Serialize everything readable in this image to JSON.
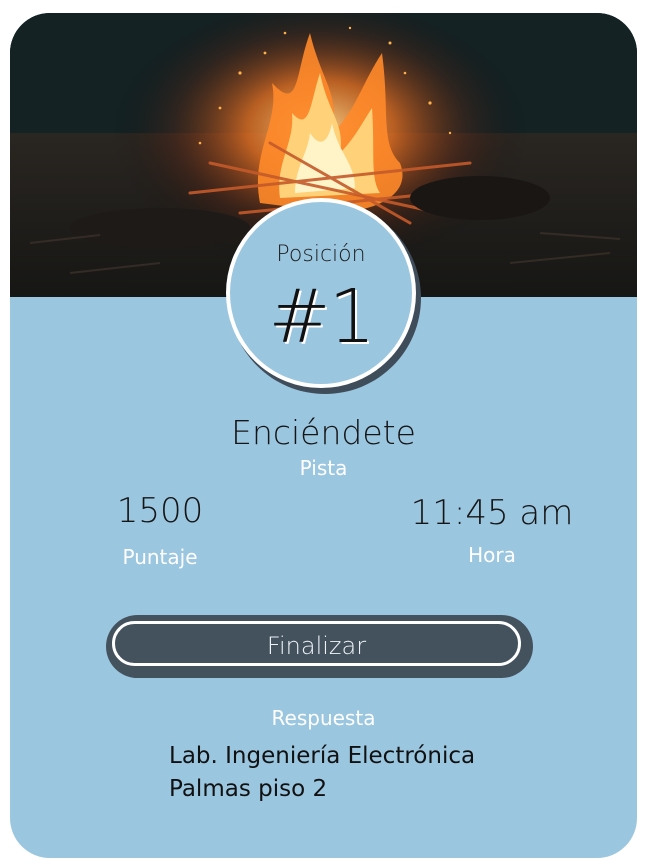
{
  "position": {
    "label": "Posición",
    "value": "#1"
  },
  "track": {
    "title": "Enciéndete",
    "subtitle": "Pista"
  },
  "stats": {
    "score_value": "1500",
    "score_label": "Puntaje",
    "time_value": "11:45 am",
    "time_label": "Hora"
  },
  "actions": {
    "finish_label": "Finalizar"
  },
  "answer": {
    "label": "Respuesta",
    "line1": "Lab. Ingeniería Electrónica",
    "line2": "Palmas piso 2"
  },
  "colors": {
    "card_background": "#9bc6e0",
    "button_background": "#44525e",
    "accent_text": "#ffffff"
  },
  "images": {
    "hero": "campfire-photo"
  }
}
